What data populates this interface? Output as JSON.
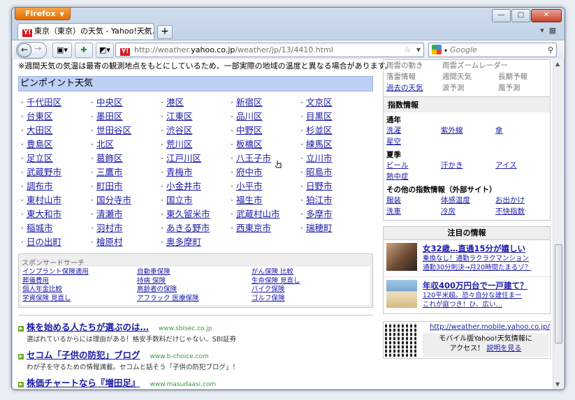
{
  "browser": {
    "app_button": "Firefox",
    "tab_title": "東京（東京）の天気 - Yahoo!天気...",
    "new_tab": "+",
    "url_prefix": "http://weather.",
    "url_domain": "yahoo.co.jp",
    "url_path": "/weather/jp/13/4410.html",
    "search_placeholder": "Google"
  },
  "page": {
    "note": "※週間天気の気温は最寄の観測地点をもとにしているため、一部実際の地域の温度と異なる場合があります。",
    "pinpoint_title": "ピンポイント天気",
    "areas": [
      "千代田区",
      "中央区",
      "港区",
      "新宿区",
      "文京区",
      "台東区",
      "墨田区",
      "江東区",
      "品川区",
      "目黒区",
      "大田区",
      "世田谷区",
      "渋谷区",
      "中野区",
      "杉並区",
      "豊島区",
      "北区",
      "荒川区",
      "板橋区",
      "練馬区",
      "足立区",
      "葛飾区",
      "江戸川区",
      "八王子市",
      "立川市",
      "武蔵野市",
      "三鷹市",
      "青梅市",
      "府中市",
      "昭島市",
      "調布市",
      "町田市",
      "小金井市",
      "小平市",
      "日野市",
      "東村山市",
      "国分寺市",
      "国立市",
      "福生市",
      "狛江市",
      "東大和市",
      "清瀬市",
      "東久留米市",
      "武蔵村山市",
      "多摩市",
      "稲城市",
      "羽村市",
      "あきる野市",
      "西東京市",
      "瑞穂町",
      "日の出町",
      "檜原村",
      "奥多摩町"
    ],
    "sponsor_title": "スポンサードサーチ",
    "sponsor_links": [
      "インプラント保険適用",
      "自動車保険",
      "がん保険 比較",
      "葬儀費用",
      "持病 保険",
      "生命保険 見直し",
      "個人年金比較",
      "高齢者の保険",
      "バイク保険",
      "学資保険 見直し",
      "アフラック 医療保険",
      "ゴルフ保険"
    ],
    "ads": [
      {
        "title": "株を始める人たちが選ぶのは…",
        "url": "www.sbisec.co.jp",
        "desc": "選ばれているからには理由がある！格安手数料だけじゃない、SBI証券"
      },
      {
        "title": "セコム「子供の防犯」ブログ",
        "url": "www.b-choice.com",
        "desc": "わが子を守るための情報満載。セコムと話そう「子供の防犯ブログ」！"
      },
      {
        "title": "株価チャートなら『増田足』",
        "url": "www.masudaasi.com",
        "desc": ""
      }
    ]
  },
  "sidebar": {
    "top_row1": [
      "雨雲の動き",
      "雨雲ズームレーダー",
      ""
    ],
    "top_row2": [
      "落雷情報",
      "週間天気",
      "長期予報"
    ],
    "top_row3_link": "過去の天気",
    "top_row3": [
      "波予測",
      "風予測"
    ],
    "index_title": "指数情報",
    "year_round": "通年",
    "year_round_links": [
      "洗濯",
      "紫外線",
      "傘",
      "星空"
    ],
    "summer": "夏季",
    "summer_links": [
      "ビール",
      "汗かき",
      "アイス",
      "熱中症"
    ],
    "external_title": "その他の指数情報（外部サイト）",
    "external_links": [
      "服装",
      "体感温度",
      "お出かけ",
      "洗車",
      "冷房",
      "不快指数"
    ],
    "attention_title": "注目の情報",
    "attention": [
      {
        "title": "女32歳…直通15分が嬉しい",
        "l1": "乗換なし！通勤ラクラクマンション",
        "l2": "通勤30分則決→月20時間たまるゾ？"
      },
      {
        "title": "年収400万円台で一戸建て？",
        "l1": "120平米超。恐々自分な建住まー",
        "l2": "これが庭つき！ひ、広い…"
      }
    ],
    "mobile_url": "http://weather.mobile.yahoo.co.jp/",
    "mobile_text": "モバイル版Yahoo!天気情報に",
    "mobile_text2": "アクセス！",
    "mobile_link": "説明を見る"
  }
}
